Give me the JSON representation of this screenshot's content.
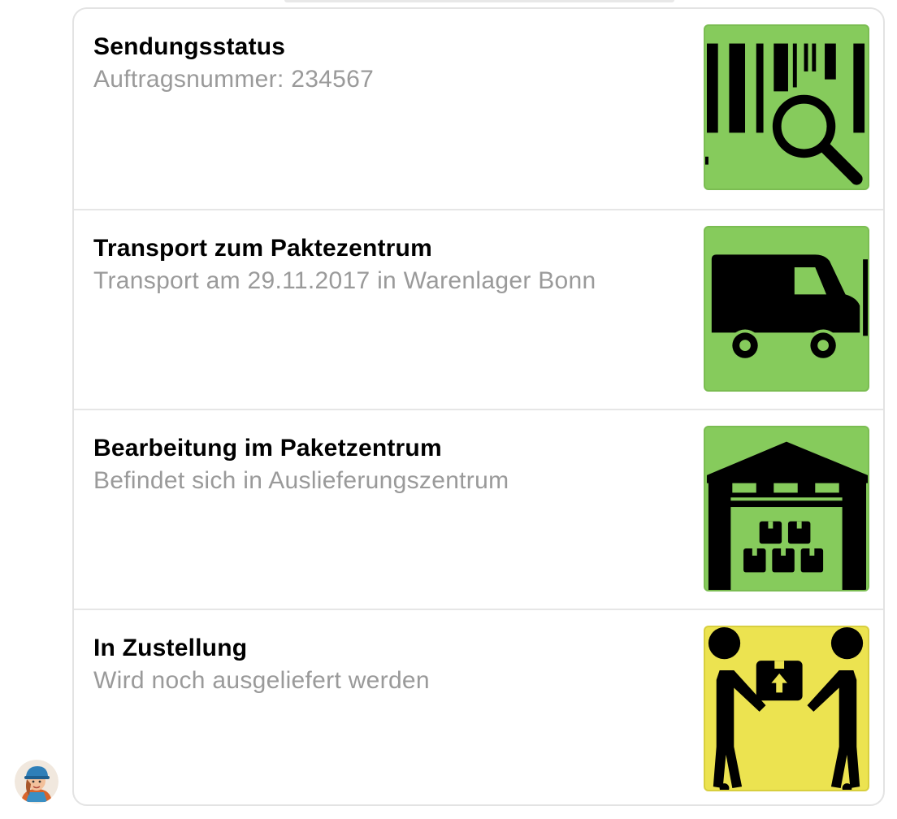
{
  "items": [
    {
      "title": "Sendungsstatus",
      "subtitle": "Auftragsnummer: 234567",
      "icon": "barcode-search-icon",
      "color": "#86cb5c"
    },
    {
      "title": "Transport zum Paktezentrum",
      "subtitle": "Transport am 29.11.2017 in Warenlager Bonn",
      "icon": "delivery-van-icon",
      "color": "#86cb5c"
    },
    {
      "title": "Bearbeitung im Paketzentrum",
      "subtitle": "Befindet sich in Auslieferungszentrum",
      "icon": "warehouse-icon",
      "color": "#86cb5c"
    },
    {
      "title": "In Zustellung",
      "subtitle": "Wird noch ausgeliefert werden",
      "icon": "package-handover-icon",
      "color": "#ece350"
    }
  ],
  "bot": {
    "avatar_icon": "delivery-person-avatar-icon"
  }
}
